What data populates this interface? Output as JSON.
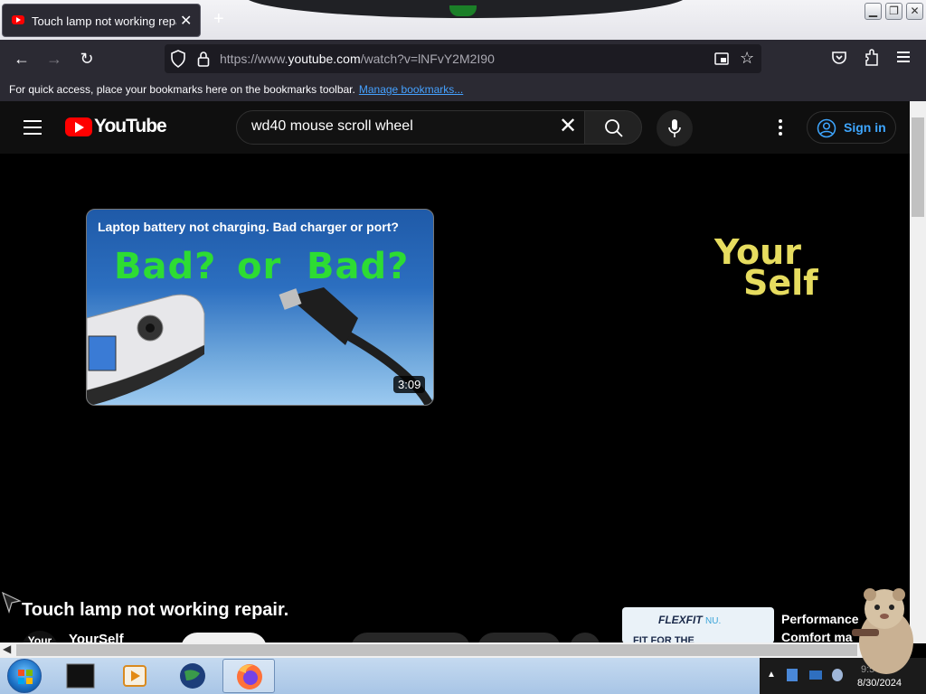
{
  "browser": {
    "tab_title": "Touch lamp not working repair.",
    "tab_close": "✕",
    "new_tab": "+",
    "url_prefix": "https://www.",
    "url_domain": "youtube.com",
    "url_suffix": "/watch?v=lNFvY2M2I90",
    "bookmarks_message": "For quick access, place your bookmarks here on the bookmarks toolbar.",
    "bookmarks_link": "Manage bookmarks..."
  },
  "youtube": {
    "logo_text": "YouTube",
    "search_value": "wd40 mouse scroll wheel",
    "search_clear": "✕",
    "signin_label": "Sign in"
  },
  "endscreen": {
    "card_title": "Laptop battery not charging. Bad charger or port?",
    "card_word_1": "Bad?",
    "card_word_2": "or",
    "card_word_3": "Bad?",
    "card_duration": "3:09",
    "channel_mark_line1": "Your",
    "channel_mark_line2": "Self"
  },
  "video": {
    "title": "Touch lamp not working repair.",
    "channel_avatar_text": "Your",
    "channel_name": "YourSelf"
  },
  "ad": {
    "brand": "FLEXFIT",
    "brand_suffix": "NU.",
    "tagline": "FIT FOR THE",
    "side_text_1": "Performance",
    "side_text_2": "Comfort ma"
  },
  "taskbar": {
    "time": "9:5",
    "date": "8/30/2024"
  },
  "colors": {
    "youtube_red": "#ff0000",
    "signin_blue": "#3ea6ff",
    "link_blue": "#45a1ff",
    "channel_mark_yellow": "#e6dc5f",
    "thumbnail_text_green": "#2ddc33"
  },
  "icons": [
    "back-arrow-icon",
    "forward-arrow-icon",
    "reload-icon",
    "shield-icon",
    "lock-icon",
    "picture-in-picture-icon",
    "star-icon",
    "pocket-icon",
    "extensions-icon",
    "menu-icon",
    "hamburger-icon",
    "search-icon",
    "microphone-icon",
    "more-vert-icon",
    "user-icon"
  ]
}
